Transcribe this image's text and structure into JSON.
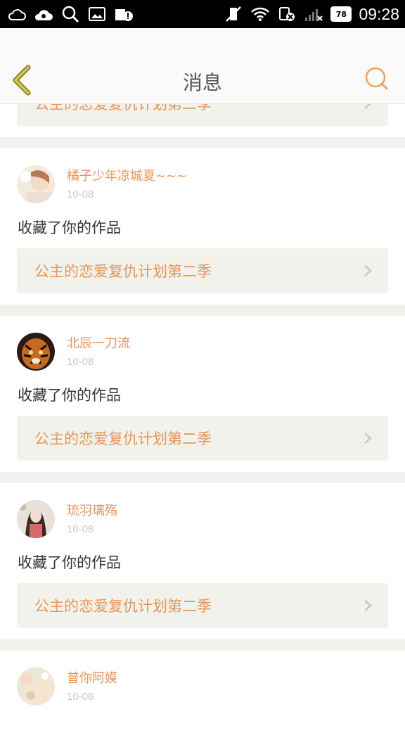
{
  "status": {
    "time": "09:28",
    "battery": "78"
  },
  "header": {
    "title": "消息"
  },
  "top_card": {
    "work_title": "公主的恋爱复仇计划第二季"
  },
  "messages": [
    {
      "user": "橘子少年凉城夏~~~",
      "date": "10-08",
      "action": "收藏了你的作品",
      "work_title": "公主的恋爱复仇计划第二季"
    },
    {
      "user": "北辰一刀流",
      "date": "10-08",
      "action": "收藏了你的作品",
      "work_title": "公主的恋爱复仇计划第二季"
    },
    {
      "user": "琉羽璃殇",
      "date": "10-08",
      "action": "收藏了你的作品",
      "work_title": "公主的恋爱复仇计划第二季"
    },
    {
      "user": "普你阿嫫",
      "date": "10-08"
    }
  ],
  "colors": {
    "accent": "#e8955a",
    "back_arrow": "#c6b22a",
    "background": "#f1f1ee"
  }
}
